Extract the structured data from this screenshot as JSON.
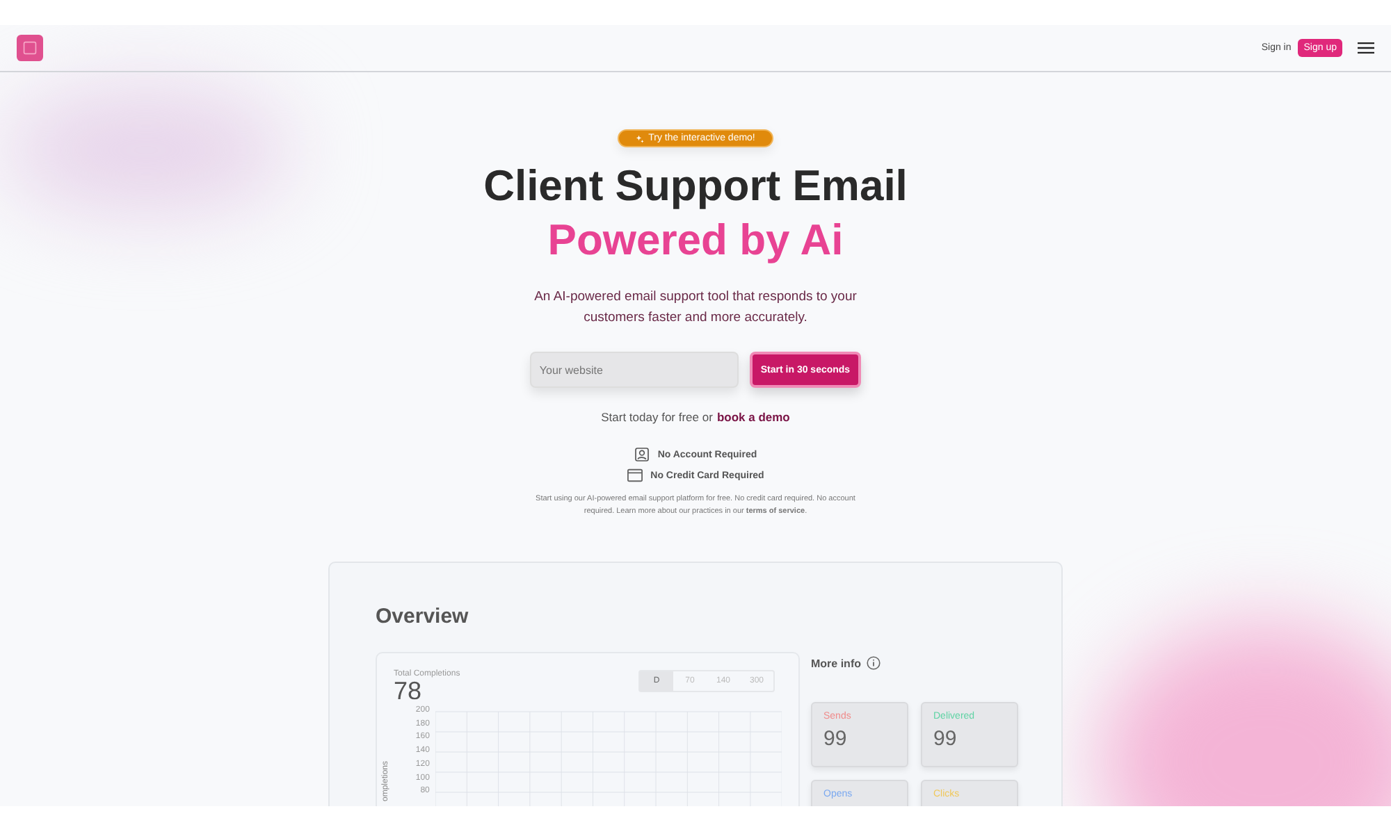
{
  "nav": {
    "sign_in": "Sign in",
    "sign_up": "Sign up"
  },
  "hero": {
    "badge": "Try the interactive demo!",
    "title": "Client Support Email",
    "title_accent": "Powered by Ai",
    "description": "An AI-powered email support tool that responds to your customers faster and more accurately.",
    "input": {
      "placeholder": "Your website"
    },
    "cta": "Start in 30 seconds",
    "note": "Start today for free or",
    "note_link": "book a demo",
    "features": [
      {
        "kind": "account",
        "label": "No Account Required"
      },
      {
        "kind": "card",
        "label": "No Credit Card Required"
      }
    ],
    "fine_print": "Start using our AI-powered email support platform for free. No credit card required. No account required. Learn more about our practices in our **terms of service**."
  },
  "overview": {
    "title": "Overview",
    "chart": {
      "label": "Total Completions",
      "value": "78",
      "ranges": [
        {
          "label": "D",
          "selected": true
        },
        {
          "label": "70",
          "selected": false
        },
        {
          "label": "140",
          "selected": false
        },
        {
          "label": "300",
          "selected": false
        }
      ],
      "y_ticks": [
        "200",
        "180",
        "160",
        "140",
        "120",
        "100",
        "80"
      ],
      "y_label": "ompletions"
    },
    "more_info": "More info",
    "stats": [
      {
        "label": "Sends",
        "value": "99",
        "color": "#f08a8a"
      },
      {
        "label": "Delivered",
        "value": "99",
        "color": "#5fd3a4"
      },
      {
        "label": "Opens",
        "color": "#7aa8f0"
      },
      {
        "label": "Clicks",
        "color": "#f0c85a"
      }
    ]
  }
}
